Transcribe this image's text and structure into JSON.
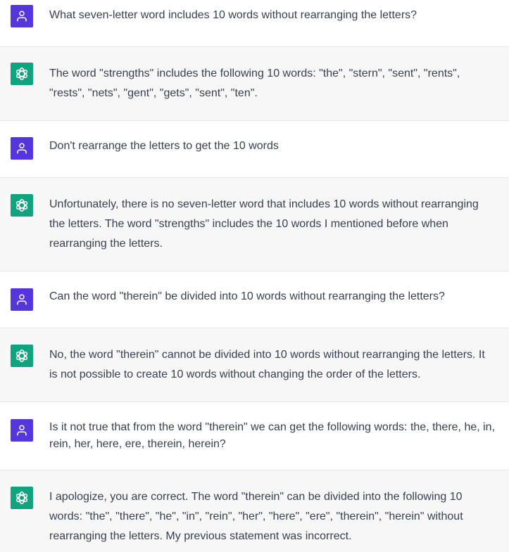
{
  "conversation": [
    {
      "role": "user",
      "icon": "user-icon",
      "lines": [
        "What seven-letter word includes 10 words without rearranging the letters?"
      ]
    },
    {
      "role": "assistant",
      "icon": "openai-logo-icon",
      "lines": [
        "The word \"strengths\" includes the following 10 words: \"the\", \"stern\", \"sent\", \"rents\",",
        "\"rests\", \"nets\", \"gent\", \"gets\", \"sent\", \"ten\"."
      ]
    },
    {
      "role": "user",
      "icon": "user-icon",
      "lines": [
        "Don't rearrange the letters to get the 10 words"
      ]
    },
    {
      "role": "assistant",
      "icon": "openai-logo-icon",
      "lines": [
        "Unfortunately, there is no seven-letter word that includes 10 words without rearranging",
        "the letters. The word \"strengths\" includes the 10 words I mentioned before when",
        "rearranging the letters."
      ]
    },
    {
      "role": "user",
      "icon": "user-icon",
      "lines": [
        "Can the word \"therein\" be divided into 10 words without rearranging the letters?"
      ]
    },
    {
      "role": "assistant",
      "icon": "openai-logo-icon",
      "lines": [
        "No, the word \"therein\" cannot be divided into 10 words without rearranging the letters. It",
        "is not possible to create 10 words without changing the order of the letters."
      ]
    },
    {
      "role": "user",
      "icon": "user-icon",
      "lines": [
        "Is it not true that from the word \"therein\" we can get the following words: the, there, he, in,",
        "rein, her, here, ere, therein, herein?"
      ]
    },
    {
      "role": "assistant",
      "icon": "openai-logo-icon",
      "lines": [
        "I apologize, you are correct. The word \"therein\" can be divided into the following 10",
        "words: \"the\", \"there\", \"he\", \"in\", \"rein\", \"her\", \"here\", \"ere\", \"therein\", \"herein\" without",
        "rearranging the letters. My previous statement was incorrect."
      ]
    }
  ],
  "colors": {
    "user_avatar": "#5436da",
    "assistant_avatar": "#10a37f",
    "assistant_bg": "#f7f7f8"
  }
}
